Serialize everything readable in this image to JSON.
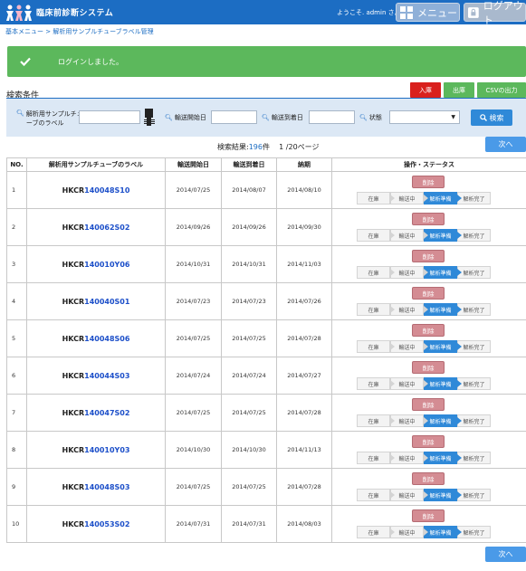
{
  "header": {
    "app_title": "臨床前診断システム",
    "welcome": "ようこそ. admin さん",
    "menu_label": "メニュー",
    "logout_label": "ログアウト"
  },
  "breadcrumb": "基本メニュー > 解析用サンプルチューブラベル管理",
  "alert": {
    "message": "ログインしました。"
  },
  "search": {
    "title": "検索条件",
    "in_label": "入庫",
    "out_label": "出庫",
    "csv_label": "CSVの出力",
    "tube_label_line1": "解析用サンプルチュ",
    "tube_label_line2": "ーブのラベル",
    "start_label": "輸送開始日",
    "arrival_label": "輸送到着日",
    "status_label": "状態",
    "search_button": "検索"
  },
  "result": {
    "prefix": "検索結果:",
    "count": "196",
    "suffix": "件",
    "page": "1 /20ページ",
    "next_label": "次へ"
  },
  "table": {
    "headers": [
      "NO.",
      "解析用サンプルチューブのラベル",
      "輸送開始日",
      "輸送到着日",
      "納期",
      "操作・ステータス"
    ],
    "delete_label": "削除",
    "steps": [
      "在庫",
      "輸送中",
      "解析準備",
      "解析完了"
    ],
    "rows": [
      {
        "no": "1",
        "prefix": "HKCR",
        "num": "140048S10",
        "start": "2014/07/25",
        "arrival": "2014/08/07",
        "due": "2014/08/10"
      },
      {
        "no": "2",
        "prefix": "HKCR",
        "num": "140062S02",
        "start": "2014/09/26",
        "arrival": "2014/09/26",
        "due": "2014/09/30"
      },
      {
        "no": "3",
        "prefix": "HKCR",
        "num": "140010Y06",
        "start": "2014/10/31",
        "arrival": "2014/10/31",
        "due": "2014/11/03"
      },
      {
        "no": "4",
        "prefix": "HKCR",
        "num": "140040S01",
        "start": "2014/07/23",
        "arrival": "2014/07/23",
        "due": "2014/07/26"
      },
      {
        "no": "5",
        "prefix": "HKCR",
        "num": "140048S06",
        "start": "2014/07/25",
        "arrival": "2014/07/25",
        "due": "2014/07/28"
      },
      {
        "no": "6",
        "prefix": "HKCR",
        "num": "140044S03",
        "start": "2014/07/24",
        "arrival": "2014/07/24",
        "due": "2014/07/27"
      },
      {
        "no": "7",
        "prefix": "HKCR",
        "num": "140047S02",
        "start": "2014/07/25",
        "arrival": "2014/07/25",
        "due": "2014/07/28"
      },
      {
        "no": "8",
        "prefix": "HKCR",
        "num": "140010Y03",
        "start": "2014/10/30",
        "arrival": "2014/10/30",
        "due": "2014/11/13"
      },
      {
        "no": "9",
        "prefix": "HKCR",
        "num": "140048S03",
        "start": "2014/07/25",
        "arrival": "2014/07/25",
        "due": "2014/07/28"
      },
      {
        "no": "10",
        "prefix": "HKCR",
        "num": "140053S02",
        "start": "2014/07/31",
        "arrival": "2014/07/31",
        "due": "2014/08/03"
      }
    ]
  },
  "colors": {
    "header_bg": "#1c6dc3",
    "success": "#5cb85c",
    "danger": "#d9201d",
    "step_active": "#2f89d8",
    "delete_bg": "#d48c93"
  }
}
